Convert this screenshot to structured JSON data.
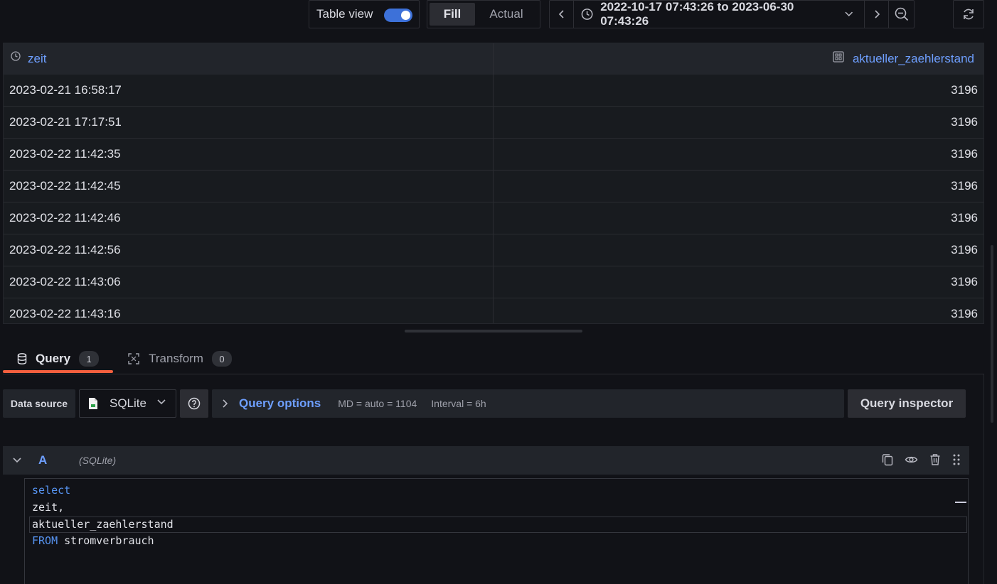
{
  "toolbar": {
    "table_view_label": "Table view",
    "table_view_on": true,
    "fill_label": "Fill",
    "actual_label": "Actual",
    "time_range": "2022-10-17 07:43:26 to 2023-06-30 07:43:26"
  },
  "table": {
    "columns": [
      "zeit",
      "aktueller_zaehlerstand"
    ],
    "rows": [
      [
        "2023-02-21 16:58:17",
        "3196"
      ],
      [
        "2023-02-21 17:17:51",
        "3196"
      ],
      [
        "2023-02-22 11:42:35",
        "3196"
      ],
      [
        "2023-02-22 11:42:45",
        "3196"
      ],
      [
        "2023-02-22 11:42:46",
        "3196"
      ],
      [
        "2023-02-22 11:42:56",
        "3196"
      ],
      [
        "2023-02-22 11:43:06",
        "3196"
      ],
      [
        "2023-02-22 11:43:16",
        "3196"
      ]
    ]
  },
  "tabs": [
    {
      "label": "Query",
      "count": "1",
      "active": true
    },
    {
      "label": "Transform",
      "count": "0",
      "active": false
    }
  ],
  "query_bar": {
    "data_source_label": "Data source",
    "data_source": "SQLite",
    "query_options_label": "Query options",
    "md": "MD = auto = 1104",
    "interval": "Interval = 6h",
    "inspector_label": "Query inspector"
  },
  "query_row": {
    "ref_id": "A",
    "ds_name": "(SQLite)"
  },
  "editor": {
    "lines": [
      "select",
      "zeit,",
      "aktueller_zaehlerstand",
      "FROM stromverbrauch"
    ],
    "line4_keyword": "FROM",
    "line4_rest": " stromverbrauch"
  },
  "colors": {
    "accent_blue": "#6e9fff",
    "toggle_blue": "#3d71d9",
    "active_tab": "#f55f3e",
    "background": "#111217"
  }
}
